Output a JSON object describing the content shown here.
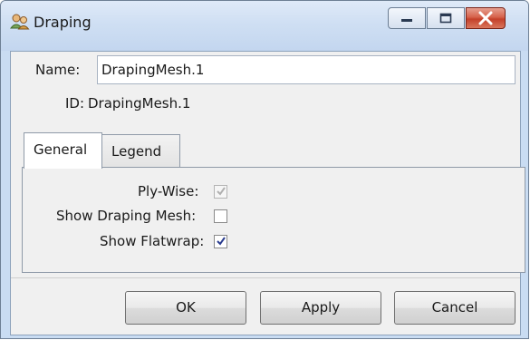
{
  "window": {
    "title": "Draping",
    "title_icon": "people-icon"
  },
  "form": {
    "name_label": "Name:",
    "name_value": "DrapingMesh.1",
    "id_label": "ID:",
    "id_value": "DrapingMesh.1"
  },
  "tabs": [
    {
      "label": "General",
      "active": true
    },
    {
      "label": "Legend",
      "active": false
    }
  ],
  "general": {
    "options": [
      {
        "label": "Ply-Wise:",
        "checked": true,
        "enabled": false
      },
      {
        "label": "Show Draping Mesh:",
        "checked": false,
        "enabled": true
      },
      {
        "label": "Show Flatwrap:",
        "checked": true,
        "enabled": true
      }
    ]
  },
  "buttons": {
    "ok": "OK",
    "apply": "Apply",
    "cancel": "Cancel"
  },
  "colors": {
    "check_enabled": "#2a3c8f",
    "check_disabled": "#b0b0b0",
    "close_button": "#c4402a"
  }
}
